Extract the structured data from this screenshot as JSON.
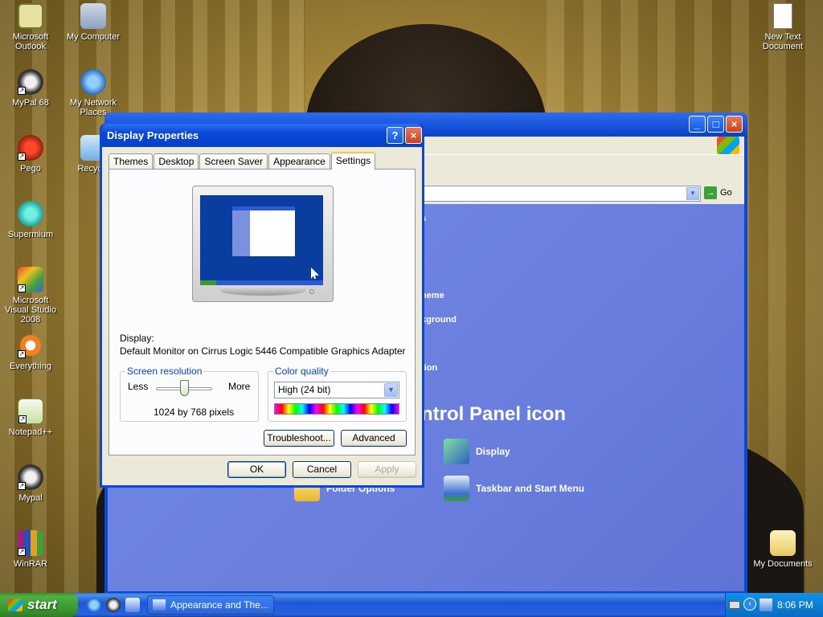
{
  "desktop": {
    "icons": [
      {
        "label": "Microsoft Outlook"
      },
      {
        "label": "My Computer"
      },
      {
        "label": "MyPal 68"
      },
      {
        "label": "My Network Places"
      },
      {
        "label": "Pego"
      },
      {
        "label": "Recycle"
      },
      {
        "label": "Supermium"
      },
      {
        "label": "Microsoft Visual Studio 2008"
      },
      {
        "label": "Everything"
      },
      {
        "label": "Notepad++"
      },
      {
        "label": "Mypal"
      },
      {
        "label": "WinRAR"
      },
      {
        "label": "New Text Document"
      },
      {
        "label": "My Documents"
      }
    ]
  },
  "background_window": {
    "title": "Appearance and Themes",
    "address_go": "Go",
    "links": [
      "s",
      "heme",
      "kground",
      "tion"
    ],
    "section_title": "ntrol Panel icon",
    "items": [
      {
        "label": "Display"
      },
      {
        "label": "Folder Options"
      },
      {
        "label": "Taskbar and Start Menu"
      }
    ]
  },
  "dialog": {
    "title": "Display Properties",
    "tabs": [
      "Themes",
      "Desktop",
      "Screen Saver",
      "Appearance",
      "Settings"
    ],
    "active_tab": "Settings",
    "display_label": "Display:",
    "display_value": "Default Monitor on Cirrus Logic 5446 Compatible Graphics Adapter",
    "resolution": {
      "legend": "Screen resolution",
      "less": "Less",
      "more": "More",
      "value": "1024 by 768 pixels"
    },
    "color_quality": {
      "legend": "Color quality",
      "selected": "High (24 bit)"
    },
    "buttons": {
      "troubleshoot": "Troubleshoot...",
      "advanced": "Advanced",
      "ok": "OK",
      "cancel": "Cancel",
      "apply": "Apply"
    }
  },
  "taskbar": {
    "start_label": "start",
    "task_button": "Appearance and The...",
    "clock": "8:06 PM"
  }
}
